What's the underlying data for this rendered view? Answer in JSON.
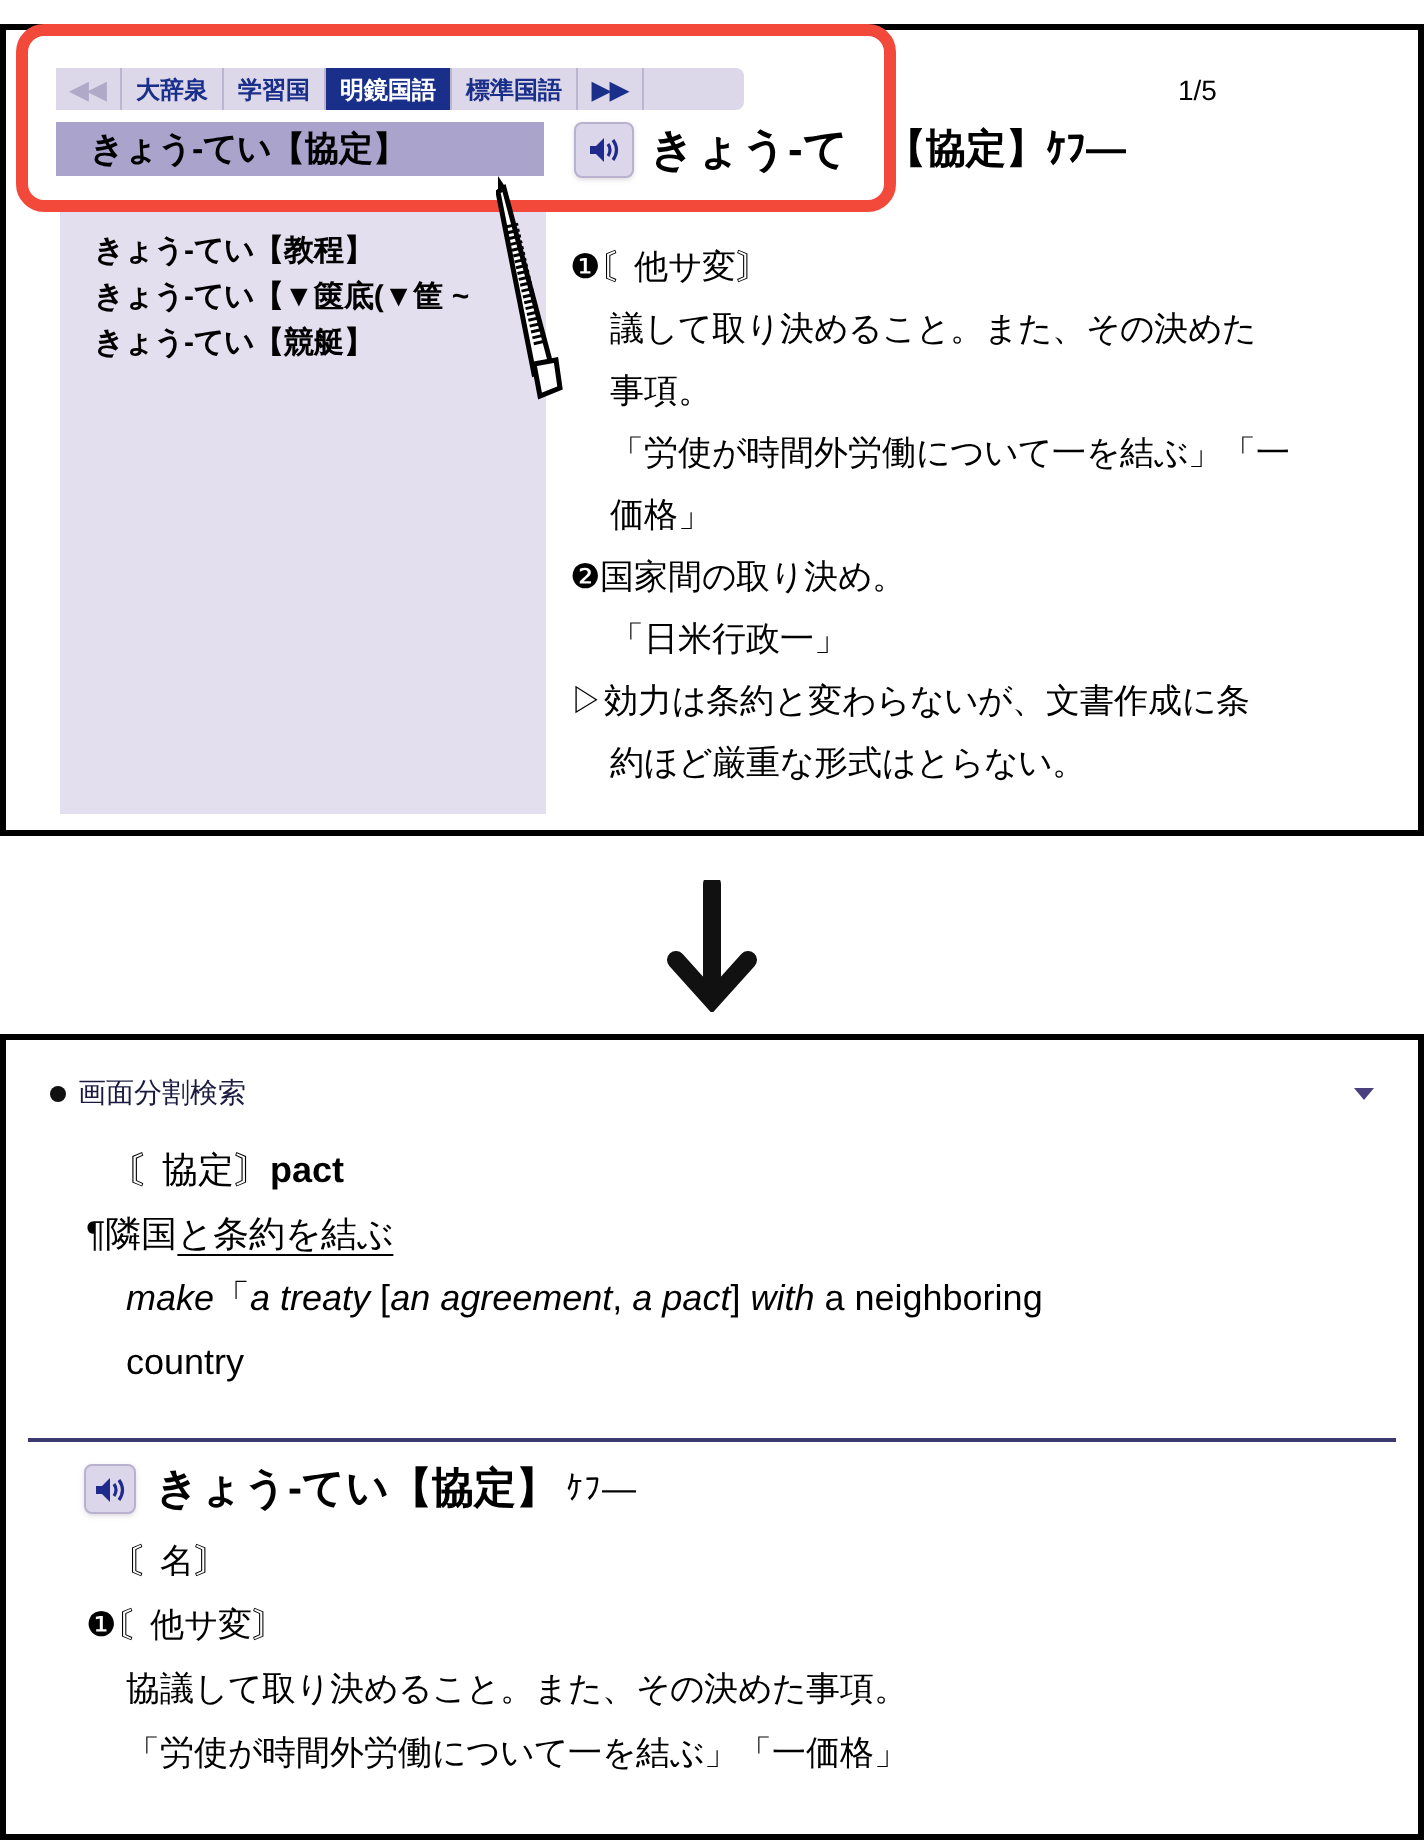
{
  "top_screen": {
    "tabs": [
      {
        "label": "◀◀",
        "disabled": true,
        "selected": false
      },
      {
        "label": "大辞泉",
        "disabled": false,
        "selected": false
      },
      {
        "label": "学習国",
        "disabled": false,
        "selected": false
      },
      {
        "label": "明鏡国語",
        "disabled": false,
        "selected": true
      },
      {
        "label": "標準国語",
        "disabled": false,
        "selected": false
      },
      {
        "label": "▶▶",
        "disabled": false,
        "selected": false
      }
    ],
    "page": "1/5",
    "selected_item": "きょう-てい【協定】",
    "list": [
      {
        "label": "きょう-てい【教程】",
        "selected": false
      },
      {
        "label": "きょう-てい【▼篋底(▼筐 ~",
        "selected": false
      },
      {
        "label": "きょう-てい【競艇】",
        "selected": false
      }
    ],
    "headword": "きょう-て",
    "headword_rest": "【協定】ｹﾌ—",
    "lines": [
      {
        "kind": "numbered",
        "text": "❶〘他サ変〙"
      },
      {
        "kind": "body",
        "text": "議して取り決めること。また、その決めた"
      },
      {
        "kind": "body",
        "text": "事項。"
      },
      {
        "kind": "body",
        "text": "「労使が時間外労働について一を結ぶ」「一"
      },
      {
        "kind": "body",
        "text": "価格」"
      },
      {
        "kind": "numbered",
        "text": "❷国家間の取り決め。"
      },
      {
        "kind": "body",
        "text": "「日米行政一」"
      },
      {
        "kind": "numbered",
        "text": "▷効力は条約と変わらないが、文書作成に条"
      },
      {
        "kind": "body",
        "text": "約ほど厳重な形式はとらない。"
      }
    ]
  },
  "bottom_screen": {
    "title": "画面分割検索",
    "entry": "〘協定〙**pact**",
    "example_prefix": "¶隣国",
    "example_underlined": "と条約を結ぶ",
    "translation": "*make*「*a treaty* [*an agreement*, *a pact*] *with* a neighboring",
    "translation_cont": "country",
    "headword": "きょう-てい【協定】",
    "reading": "ｹﾌ—",
    "lines": [
      {
        "kind": "body",
        "text": "〘名〙"
      },
      {
        "kind": "numbered",
        "text": "❶〘他サ変〙"
      },
      {
        "kind": "body",
        "text": "協議して取り決めること。また、その決めた事項。"
      },
      {
        "kind": "body",
        "text": "「労使が時間外労働について一を結ぶ」「一価格」"
      }
    ]
  }
}
